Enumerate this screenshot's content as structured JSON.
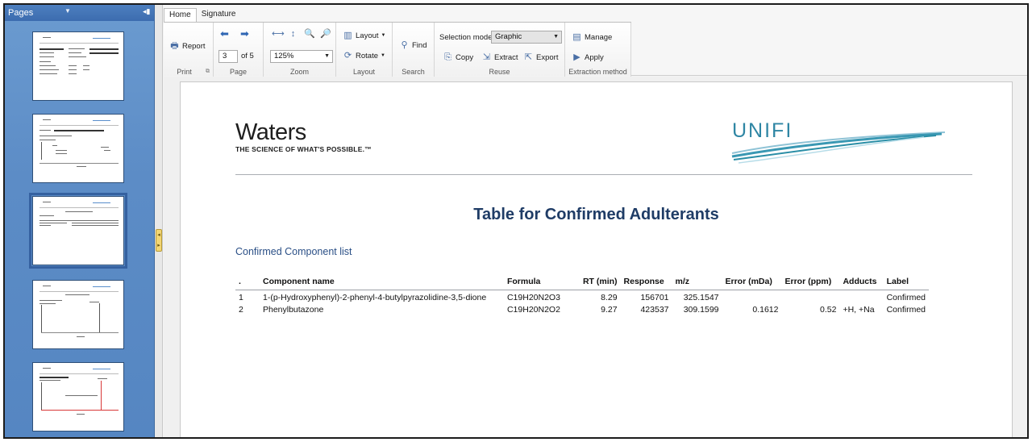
{
  "pages_pane": {
    "title": "Pages",
    "page_count": 5,
    "selected_page": 3
  },
  "tabs": [
    {
      "label": "Home",
      "active": true
    },
    {
      "label": "Signature",
      "active": false
    }
  ],
  "ribbon": {
    "print": {
      "report_label": "Report",
      "caption": "Print"
    },
    "page": {
      "current": "3",
      "of_label": "of 5",
      "caption": "Page"
    },
    "zoom": {
      "value": "125%",
      "caption": "Zoom"
    },
    "layout": {
      "layout_label": "Layout",
      "rotate_label": "Rotate",
      "caption": "Layout"
    },
    "search": {
      "find_label": "Find",
      "caption": "Search"
    },
    "reuse": {
      "selection_mode_label": "Selection mode",
      "selection_mode_value": "Graphic",
      "copy_label": "Copy",
      "extract_label": "Extract",
      "export_label": "Export",
      "caption": "Reuse"
    },
    "extraction": {
      "manage_label": "Manage",
      "apply_label": "Apply",
      "caption": "Extraction method"
    }
  },
  "document": {
    "logo_left": {
      "name": "Waters",
      "tagline": "THE SCIENCE OF WHAT'S POSSIBLE.™"
    },
    "logo_right": {
      "name": "UNIFI"
    },
    "title": "Table for Confirmed Adulterants",
    "subheading": "Confirmed Component list",
    "table": {
      "columns": [
        ".",
        "Component name",
        "Formula",
        "RT (min)",
        "Response",
        "m/z",
        "Error (mDa)",
        "Error (ppm)",
        "Adducts",
        "Label"
      ],
      "rows": [
        {
          "idx": "1",
          "name": "1-(p-Hydroxyphenyl)-2-phenyl-4-butylpyrazolidine-3,5-dione",
          "formula": "C19H20N2O3",
          "rt": "8.29",
          "response": "156701",
          "mz": "325.1547",
          "err_mda": "",
          "err_ppm": "",
          "adducts": "",
          "label": "Confirmed"
        },
        {
          "idx": "2",
          "name": "Phenylbutazone",
          "formula": "C19H20N2O2",
          "rt": "9.27",
          "response": "423537",
          "mz": "309.1599",
          "err_mda": "0.1612",
          "err_ppm": "0.52",
          "adducts": "+H, +Na",
          "label": "Confirmed"
        }
      ]
    }
  },
  "colors": {
    "pane_blue": "#5c8cc6",
    "title_navy": "#1f3c66",
    "subhead_blue": "#2a4f86",
    "unifi_teal": "#2a8ea6"
  }
}
